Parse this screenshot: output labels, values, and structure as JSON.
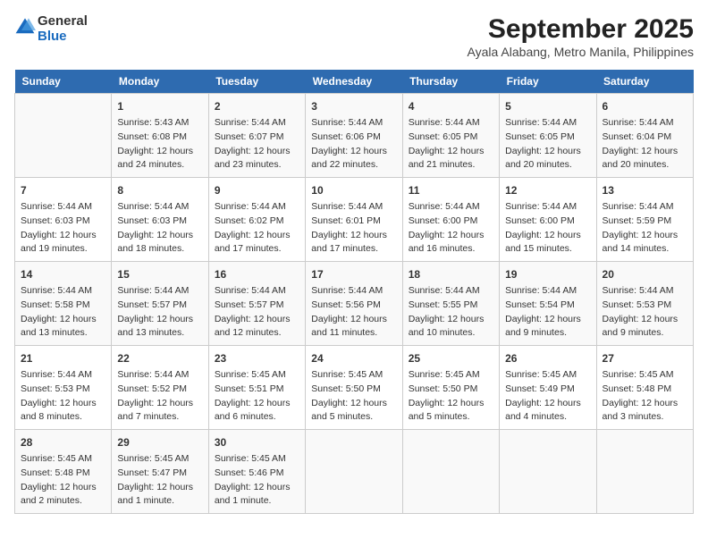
{
  "header": {
    "logo_general": "General",
    "logo_blue": "Blue",
    "title": "September 2025",
    "subtitle": "Ayala Alabang, Metro Manila, Philippines"
  },
  "days_of_week": [
    "Sunday",
    "Monday",
    "Tuesday",
    "Wednesday",
    "Thursday",
    "Friday",
    "Saturday"
  ],
  "weeks": [
    [
      {
        "day": "",
        "info": ""
      },
      {
        "day": "1",
        "info": "Sunrise: 5:43 AM\nSunset: 6:08 PM\nDaylight: 12 hours\nand 24 minutes."
      },
      {
        "day": "2",
        "info": "Sunrise: 5:44 AM\nSunset: 6:07 PM\nDaylight: 12 hours\nand 23 minutes."
      },
      {
        "day": "3",
        "info": "Sunrise: 5:44 AM\nSunset: 6:06 PM\nDaylight: 12 hours\nand 22 minutes."
      },
      {
        "day": "4",
        "info": "Sunrise: 5:44 AM\nSunset: 6:05 PM\nDaylight: 12 hours\nand 21 minutes."
      },
      {
        "day": "5",
        "info": "Sunrise: 5:44 AM\nSunset: 6:05 PM\nDaylight: 12 hours\nand 20 minutes."
      },
      {
        "day": "6",
        "info": "Sunrise: 5:44 AM\nSunset: 6:04 PM\nDaylight: 12 hours\nand 20 minutes."
      }
    ],
    [
      {
        "day": "7",
        "info": "Sunrise: 5:44 AM\nSunset: 6:03 PM\nDaylight: 12 hours\nand 19 minutes."
      },
      {
        "day": "8",
        "info": "Sunrise: 5:44 AM\nSunset: 6:03 PM\nDaylight: 12 hours\nand 18 minutes."
      },
      {
        "day": "9",
        "info": "Sunrise: 5:44 AM\nSunset: 6:02 PM\nDaylight: 12 hours\nand 17 minutes."
      },
      {
        "day": "10",
        "info": "Sunrise: 5:44 AM\nSunset: 6:01 PM\nDaylight: 12 hours\nand 17 minutes."
      },
      {
        "day": "11",
        "info": "Sunrise: 5:44 AM\nSunset: 6:00 PM\nDaylight: 12 hours\nand 16 minutes."
      },
      {
        "day": "12",
        "info": "Sunrise: 5:44 AM\nSunset: 6:00 PM\nDaylight: 12 hours\nand 15 minutes."
      },
      {
        "day": "13",
        "info": "Sunrise: 5:44 AM\nSunset: 5:59 PM\nDaylight: 12 hours\nand 14 minutes."
      }
    ],
    [
      {
        "day": "14",
        "info": "Sunrise: 5:44 AM\nSunset: 5:58 PM\nDaylight: 12 hours\nand 13 minutes."
      },
      {
        "day": "15",
        "info": "Sunrise: 5:44 AM\nSunset: 5:57 PM\nDaylight: 12 hours\nand 13 minutes."
      },
      {
        "day": "16",
        "info": "Sunrise: 5:44 AM\nSunset: 5:57 PM\nDaylight: 12 hours\nand 12 minutes."
      },
      {
        "day": "17",
        "info": "Sunrise: 5:44 AM\nSunset: 5:56 PM\nDaylight: 12 hours\nand 11 minutes."
      },
      {
        "day": "18",
        "info": "Sunrise: 5:44 AM\nSunset: 5:55 PM\nDaylight: 12 hours\nand 10 minutes."
      },
      {
        "day": "19",
        "info": "Sunrise: 5:44 AM\nSunset: 5:54 PM\nDaylight: 12 hours\nand 9 minutes."
      },
      {
        "day": "20",
        "info": "Sunrise: 5:44 AM\nSunset: 5:53 PM\nDaylight: 12 hours\nand 9 minutes."
      }
    ],
    [
      {
        "day": "21",
        "info": "Sunrise: 5:44 AM\nSunset: 5:53 PM\nDaylight: 12 hours\nand 8 minutes."
      },
      {
        "day": "22",
        "info": "Sunrise: 5:44 AM\nSunset: 5:52 PM\nDaylight: 12 hours\nand 7 minutes."
      },
      {
        "day": "23",
        "info": "Sunrise: 5:45 AM\nSunset: 5:51 PM\nDaylight: 12 hours\nand 6 minutes."
      },
      {
        "day": "24",
        "info": "Sunrise: 5:45 AM\nSunset: 5:50 PM\nDaylight: 12 hours\nand 5 minutes."
      },
      {
        "day": "25",
        "info": "Sunrise: 5:45 AM\nSunset: 5:50 PM\nDaylight: 12 hours\nand 5 minutes."
      },
      {
        "day": "26",
        "info": "Sunrise: 5:45 AM\nSunset: 5:49 PM\nDaylight: 12 hours\nand 4 minutes."
      },
      {
        "day": "27",
        "info": "Sunrise: 5:45 AM\nSunset: 5:48 PM\nDaylight: 12 hours\nand 3 minutes."
      }
    ],
    [
      {
        "day": "28",
        "info": "Sunrise: 5:45 AM\nSunset: 5:48 PM\nDaylight: 12 hours\nand 2 minutes."
      },
      {
        "day": "29",
        "info": "Sunrise: 5:45 AM\nSunset: 5:47 PM\nDaylight: 12 hours\nand 1 minute."
      },
      {
        "day": "30",
        "info": "Sunrise: 5:45 AM\nSunset: 5:46 PM\nDaylight: 12 hours\nand 1 minute."
      },
      {
        "day": "",
        "info": ""
      },
      {
        "day": "",
        "info": ""
      },
      {
        "day": "",
        "info": ""
      },
      {
        "day": "",
        "info": ""
      }
    ]
  ]
}
